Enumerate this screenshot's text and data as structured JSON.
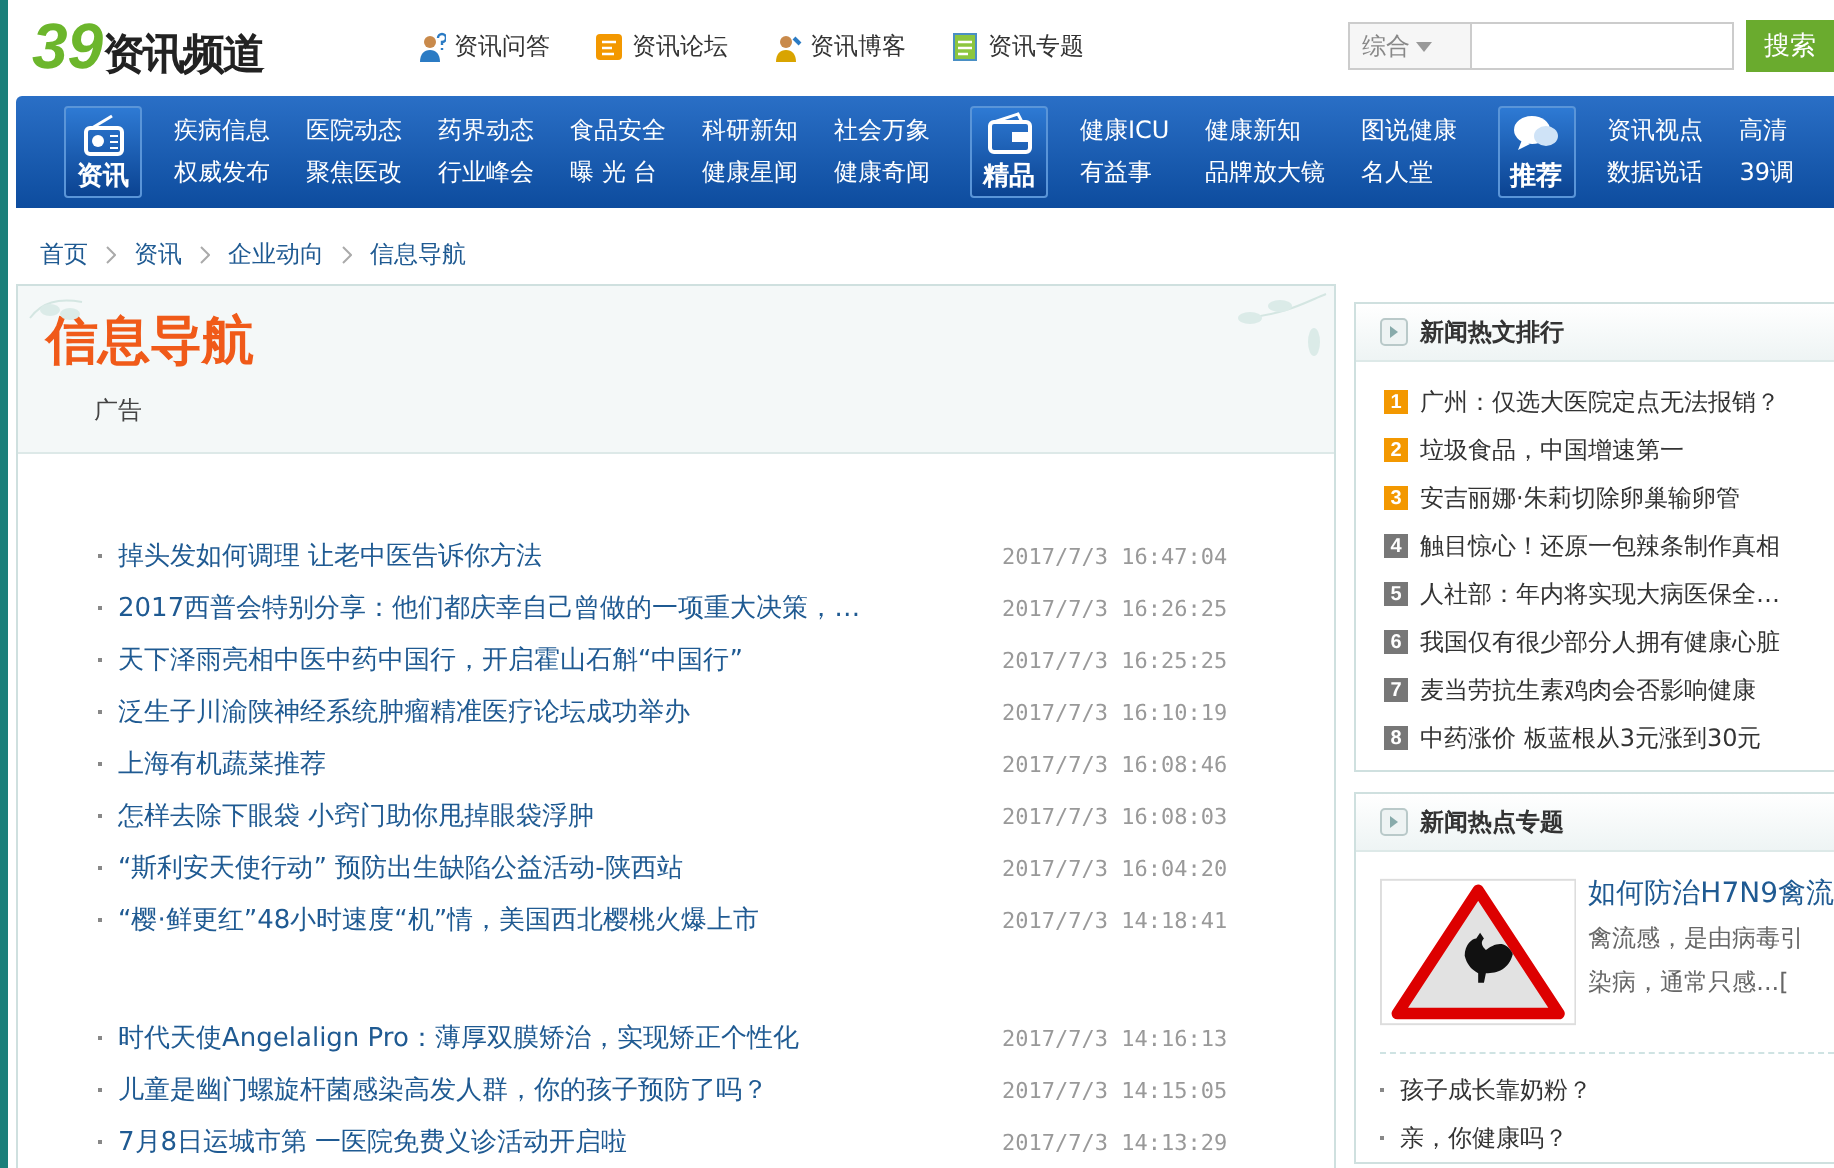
{
  "logo": {
    "number": "39",
    "text": "资讯频道"
  },
  "top_links": [
    {
      "label": "资讯问答"
    },
    {
      "label": "资讯论坛"
    },
    {
      "label": "资讯博客"
    },
    {
      "label": "资讯专题"
    }
  ],
  "search": {
    "scope": "综合",
    "button": "搜索"
  },
  "nav": [
    {
      "label": "资讯",
      "columns": [
        [
          "疾病信息",
          "权威发布"
        ],
        [
          "医院动态",
          "聚焦医改"
        ],
        [
          "药界动态",
          "行业峰会"
        ],
        [
          "食品安全",
          "曝 光 台"
        ],
        [
          "科研新知",
          "健康星闻"
        ],
        [
          "社会万象",
          "健康奇闻"
        ]
      ]
    },
    {
      "label": "精品",
      "columns": [
        [
          "健康ICU",
          "有益事"
        ],
        [
          "健康新知",
          "品牌放大镜"
        ],
        [
          "图说健康",
          "名人堂"
        ]
      ]
    },
    {
      "label": "推荐",
      "columns": [
        [
          "资讯视点",
          "数据说话"
        ],
        [
          "高清",
          "39调"
        ]
      ]
    }
  ],
  "breadcrumb": [
    "首页",
    "资讯",
    "企业动向",
    "信息导航"
  ],
  "panel": {
    "title": "信息导航",
    "tag": "广告",
    "article_groups": [
      [
        {
          "title": "掉头发如何调理 让老中医告诉你方法",
          "time": "2017/7/3 16:47:04"
        },
        {
          "title": "2017西普会特别分享：他们都庆幸自己曾做的一项重大决策，…",
          "time": "2017/7/3 16:26:25"
        },
        {
          "title": "天下泽雨亮相中医中药中国行，开启霍山石斛“中国行”",
          "time": "2017/7/3 16:25:25"
        },
        {
          "title": "泛生子川渝陕神经系统肿瘤精准医疗论坛成功举办",
          "time": "2017/7/3 16:10:19"
        },
        {
          "title": "上海有机蔬菜推荐",
          "time": "2017/7/3 16:08:46"
        },
        {
          "title": "怎样去除下眼袋 小窍门助你甩掉眼袋浮肿",
          "time": "2017/7/3 16:08:03"
        },
        {
          "title": "“斯利安天使行动” 预防出生缺陷公益活动-陕西站",
          "time": "2017/7/3 16:04:20"
        },
        {
          "title": "“樱·鲜更红”48小时速度“机”情，美国西北樱桃火爆上市",
          "time": "2017/7/3 14:18:41"
        }
      ],
      [
        {
          "title": "时代天使Angelalign Pro：薄厚双膜矫治，实现矫正个性化",
          "time": "2017/7/3 14:16:13"
        },
        {
          "title": "儿童是幽门螺旋杆菌感染高发人群，你的孩子预防了吗？",
          "time": "2017/7/3 14:15:05"
        },
        {
          "title": "7月8日运城市第 一医院免费义诊活动开启啦",
          "time": "2017/7/3 14:13:29"
        }
      ]
    ]
  },
  "ranking": {
    "title": "新闻热文排行",
    "items": [
      {
        "rank": "1",
        "text": "广州：仅选大医院定点无法报销？",
        "color": "#f39800"
      },
      {
        "rank": "2",
        "text": "垃圾食品，中国增速第一",
        "color": "#f39800"
      },
      {
        "rank": "3",
        "text": "安吉丽娜·朱莉切除卵巢输卵管",
        "color": "#f39800"
      },
      {
        "rank": "4",
        "text": "触目惊心！还原一包辣条制作真相",
        "color": "#777777"
      },
      {
        "rank": "5",
        "text": "人社部：年内将实现大病医保全…",
        "color": "#777777"
      },
      {
        "rank": "6",
        "text": "我国仅有很少部分人拥有健康心脏",
        "color": "#777777"
      },
      {
        "rank": "7",
        "text": "麦当劳抗生素鸡肉会否影响健康",
        "color": "#777777"
      },
      {
        "rank": "8",
        "text": "中药涨价 板蓝根从3元涨到30元",
        "color": "#777777"
      }
    ]
  },
  "topics": {
    "title": "新闻热点专题",
    "feature": {
      "title": "如何防治H7N9禽流",
      "summary": [
        "禽流感，是由病毒引",
        "染病，通常只感...["
      ]
    },
    "items": [
      "孩子成长靠奶粉？",
      "亲，你健康吗？"
    ]
  }
}
